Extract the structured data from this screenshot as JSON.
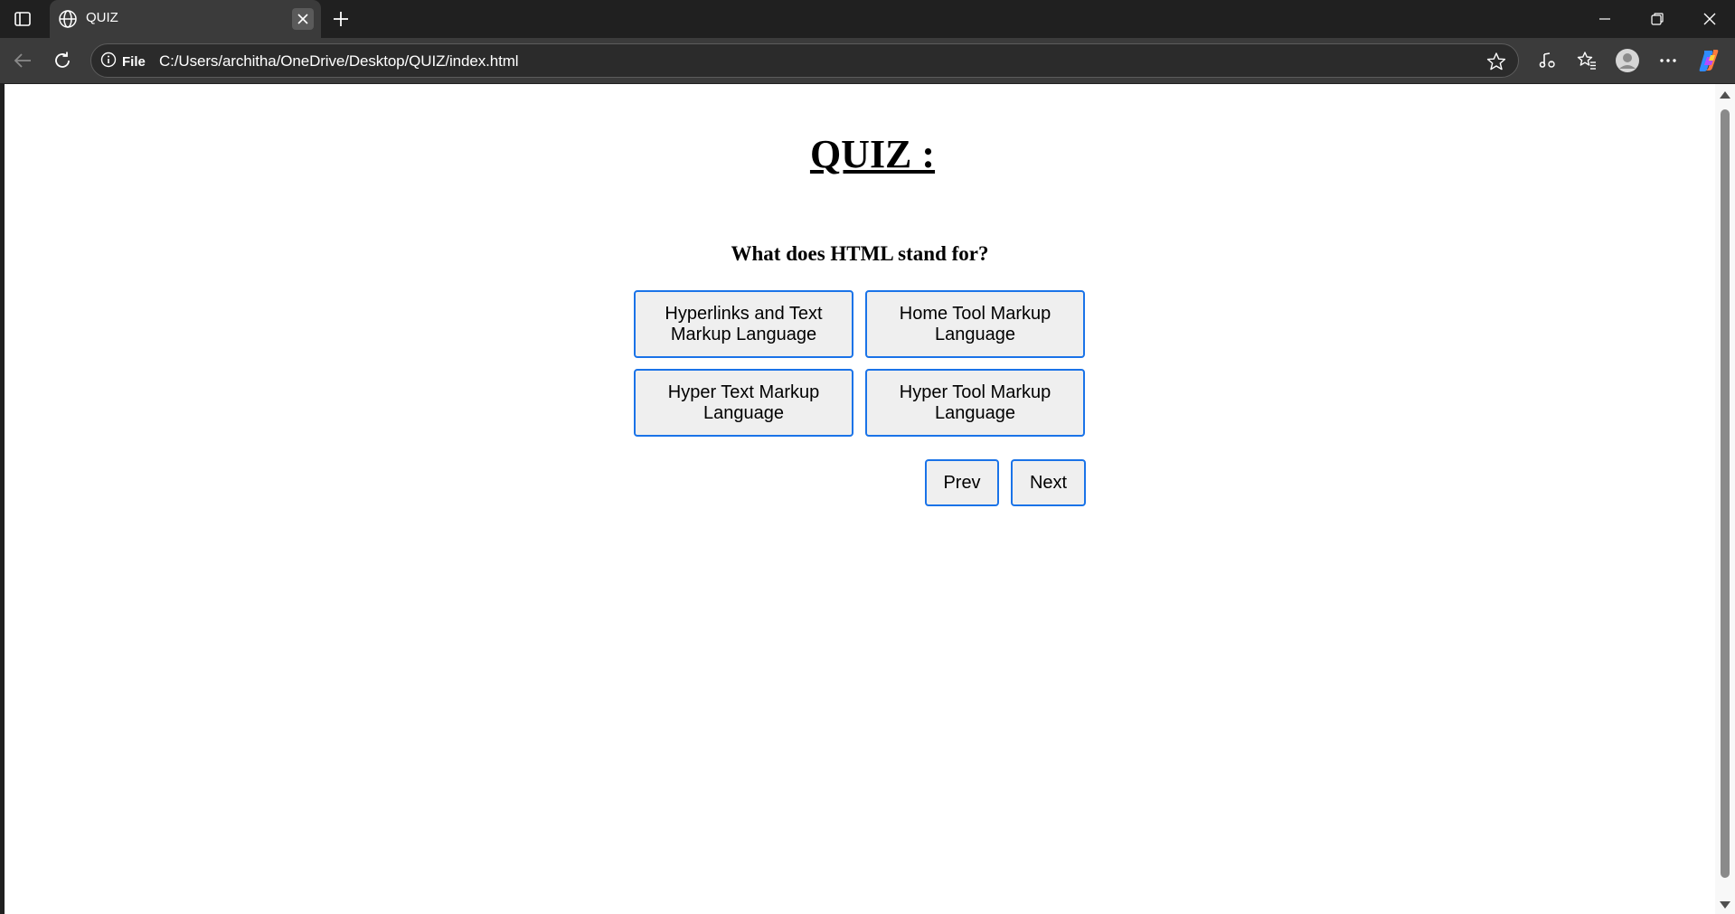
{
  "browser": {
    "tab": {
      "title": "QUIZ"
    },
    "address": {
      "scheme_label": "File",
      "url": "C:/Users/architha/OneDrive/Desktop/QUIZ/index.html"
    }
  },
  "quiz": {
    "title": "QUIZ :",
    "question": "What does HTML stand for?",
    "options": [
      "Hyperlinks and Text Markup Language",
      "Home Tool Markup Language",
      "Hyper Text Markup Language",
      "Hyper Tool Markup Language"
    ],
    "prev_label": "Prev",
    "next_label": "Next"
  },
  "colors": {
    "chrome_dark": "#202020",
    "chrome_toolbar": "#3b3b3b",
    "button_border": "#1a73e8",
    "button_bg": "#efefef"
  }
}
